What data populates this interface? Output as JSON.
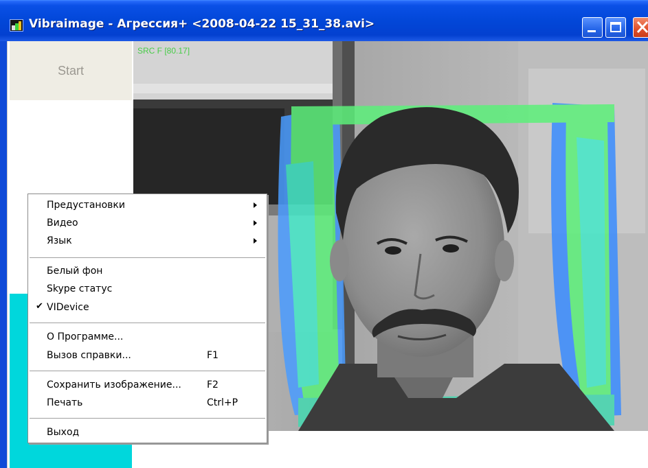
{
  "window": {
    "title": "Vibraimage - Агрессия+ <2008-04-22 15_31_38.avi>",
    "icons": [
      "app-icon",
      "minimize-icon",
      "maximize-icon",
      "close-icon"
    ]
  },
  "sidebar": {
    "start_label": "Start",
    "indicator_color": "#00d7dc"
  },
  "video": {
    "overlay_label": "SRC F [80.17]",
    "overlay_colors": [
      "#2e8cff",
      "#44e8c8",
      "#5cf07a",
      "#8ad8ff"
    ]
  },
  "context_menu": {
    "items": [
      {
        "label": "Предустановки",
        "submenu": true
      },
      {
        "label": "Видео",
        "submenu": true
      },
      {
        "label": "Язык",
        "submenu": true
      },
      {
        "label": "Белый фон"
      },
      {
        "label": "Skype статус"
      },
      {
        "label": "VIDevice",
        "checked": true,
        "check_glyph": "✔"
      },
      {
        "label": "О Программе..."
      },
      {
        "label": "Вызов справки...",
        "shortcut": "F1"
      },
      {
        "label": "Сохранить изображение...",
        "shortcut": "F2"
      },
      {
        "label": "Печать",
        "shortcut": "Ctrl+P"
      },
      {
        "label": "Выход"
      }
    ]
  }
}
